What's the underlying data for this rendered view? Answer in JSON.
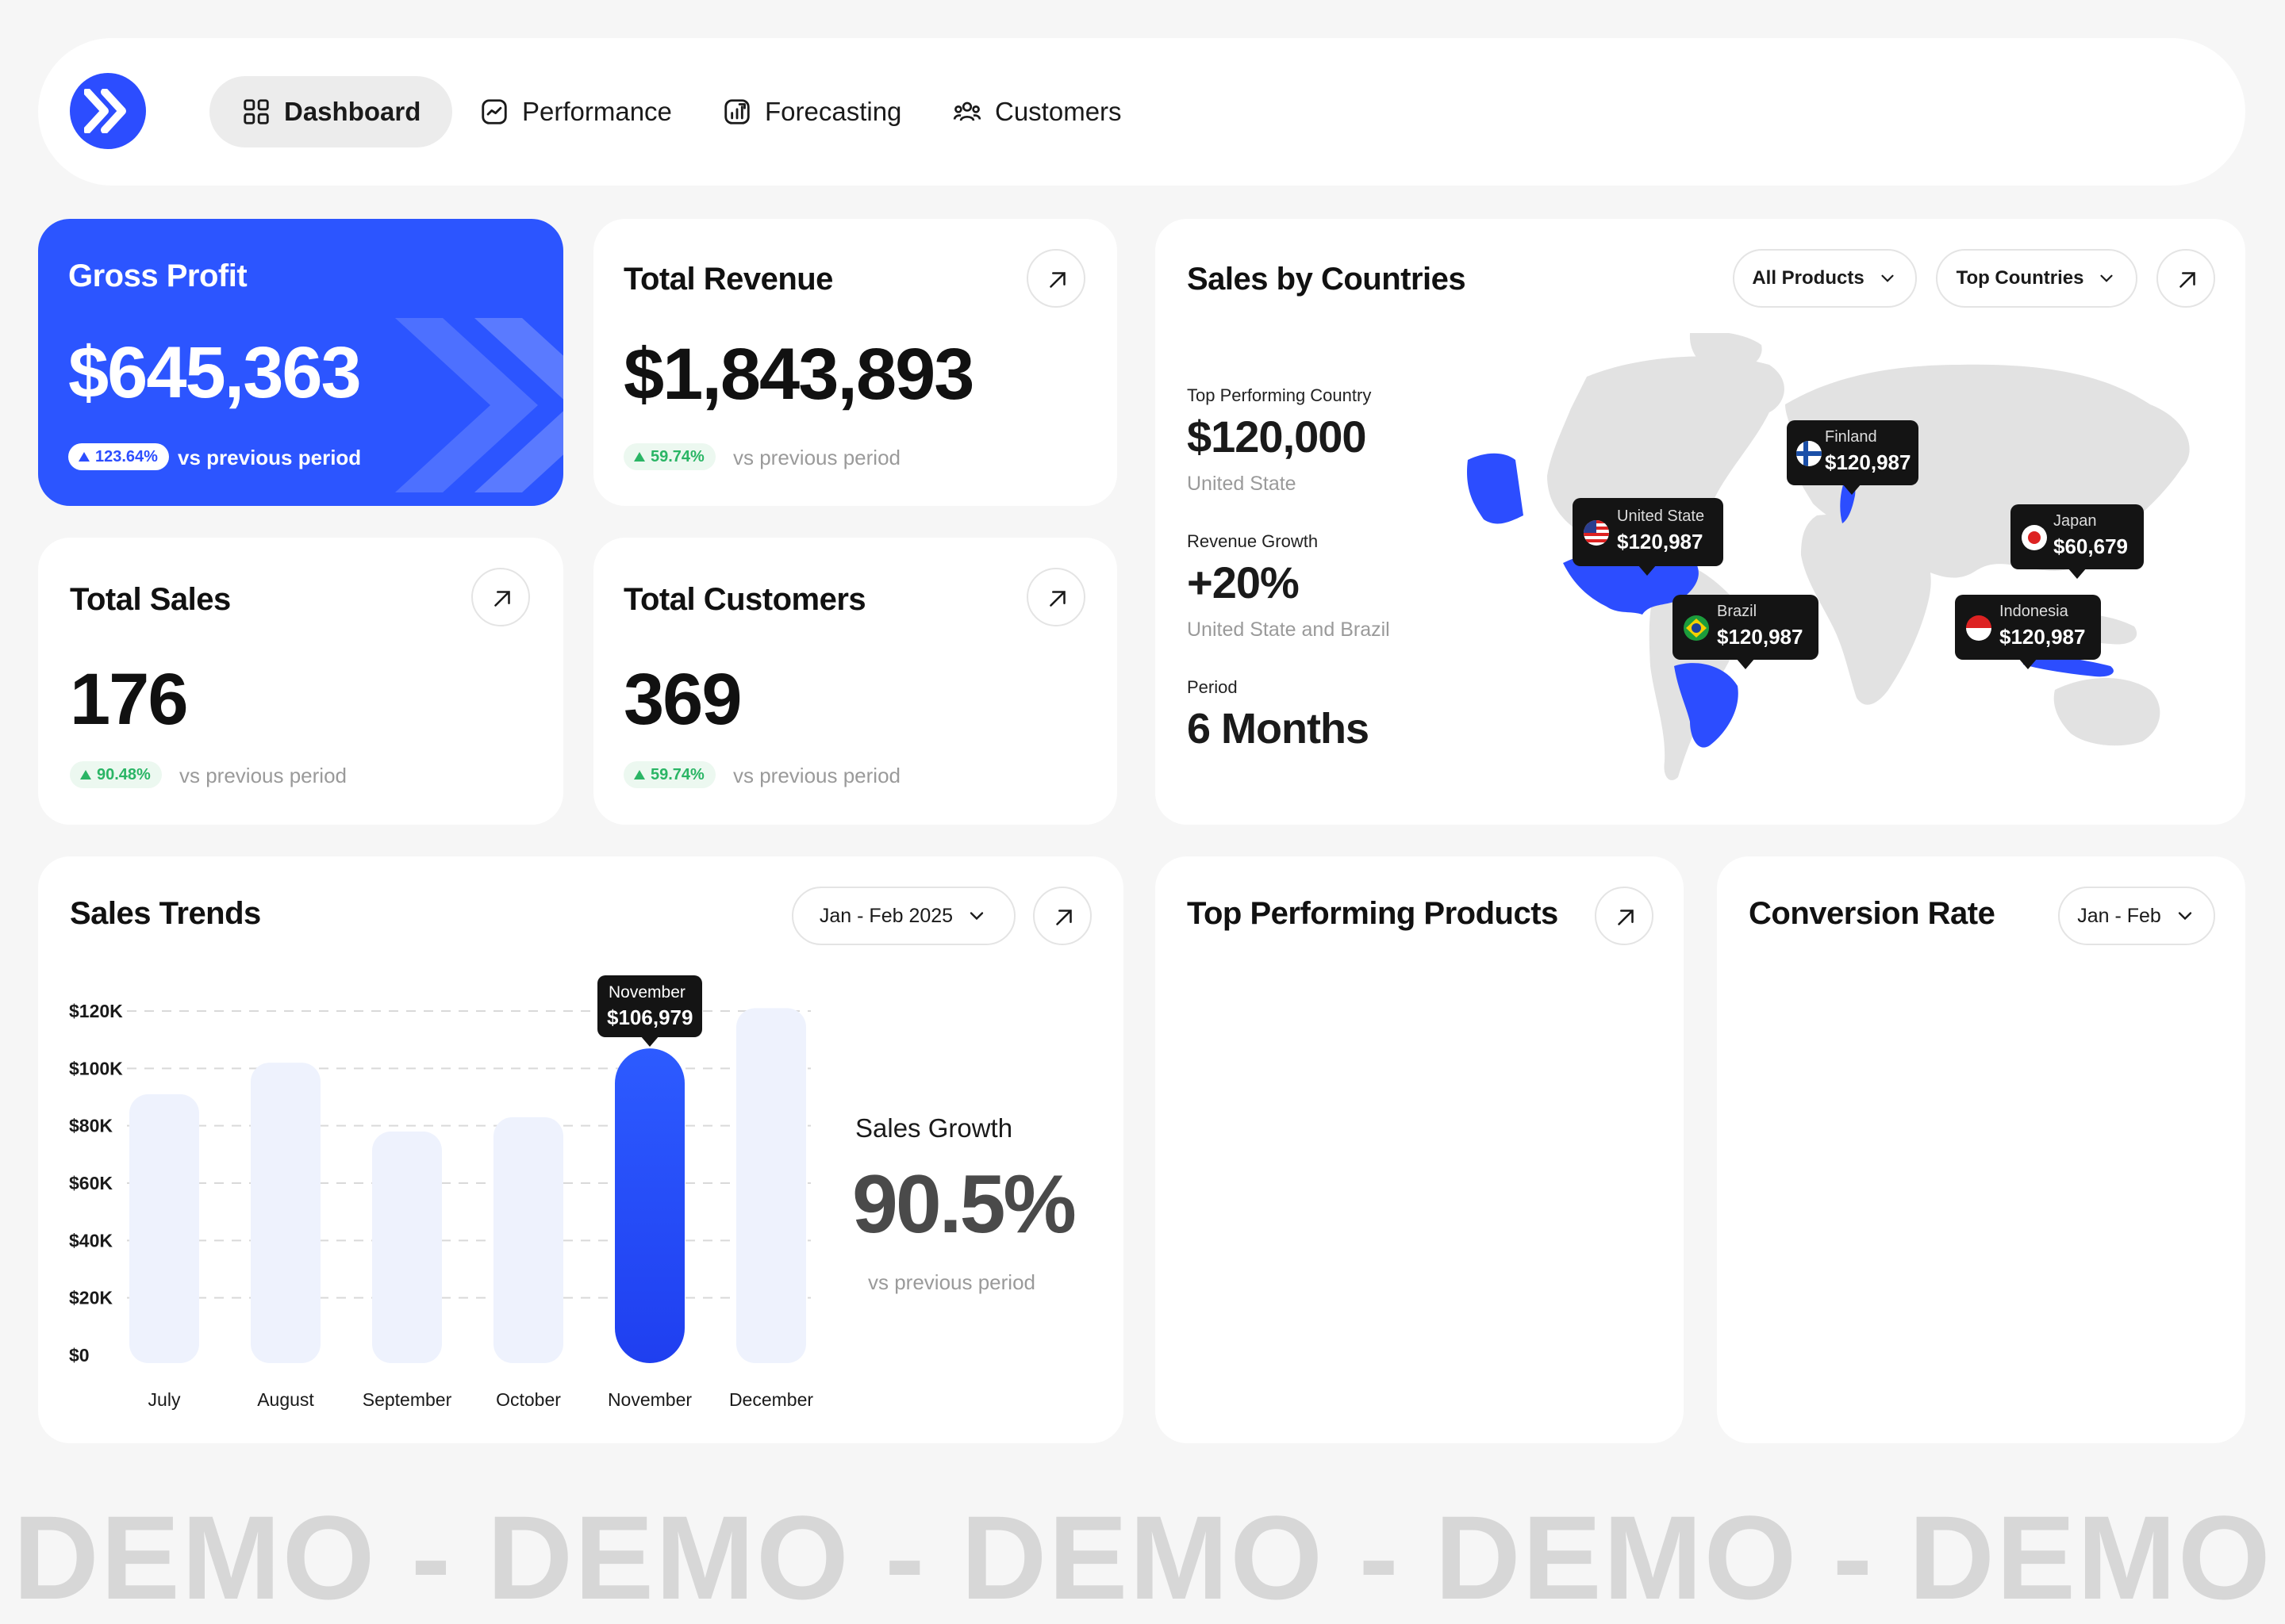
{
  "nav": {
    "tabs": [
      {
        "label": "Dashboard",
        "active": true
      },
      {
        "label": "Performance"
      },
      {
        "label": "Forecasting"
      },
      {
        "label": "Customers"
      }
    ]
  },
  "gross_profit": {
    "title": "Gross Profit",
    "value": "$645,363",
    "change": "123.64%",
    "vs": "vs previous period"
  },
  "total_revenue": {
    "title": "Total Revenue",
    "value": "$1,843,893",
    "change": "59.74%",
    "vs": "vs previous period"
  },
  "total_sales": {
    "title": "Total Sales",
    "value": "176",
    "change": "90.48%",
    "vs": "vs previous period"
  },
  "total_customers": {
    "title": "Total Customers",
    "value": "369",
    "change": "59.74%",
    "vs": "vs previous period"
  },
  "countries": {
    "title": "Sales by Countries",
    "filter_products": "All Products",
    "filter_countries": "Top Countries",
    "top_label": "Top Performing Country",
    "top_value": "$120,000",
    "top_country": "United State",
    "growth_label": "Revenue Growth",
    "growth_value": "+20%",
    "growth_countries": "United State and Brazil",
    "period_label": "Period",
    "period_value": "6 Months",
    "markers": [
      {
        "name": "United State",
        "value": "$120,987"
      },
      {
        "name": "Finland",
        "value": "$120,987"
      },
      {
        "name": "Japan",
        "value": "$60,679"
      },
      {
        "name": "Brazil",
        "value": "$120,987"
      },
      {
        "name": "Indonesia",
        "value": "$120,987"
      }
    ]
  },
  "sales_trends": {
    "title": "Sales Trends",
    "range": "Jan - Feb 2025",
    "growth_label": "Sales Growth",
    "growth_value": "90.5%",
    "growth_vs": "vs previous period",
    "tooltip_month": "November",
    "tooltip_value": "$106,979"
  },
  "top_products": {
    "title": "Top Performing Products"
  },
  "conversion": {
    "title": "Conversion Rate",
    "range": "Jan - Feb"
  },
  "watermark": "DEMO - DEMO - DEMO - DEMO - DEMO",
  "colors": {
    "accent": "#2c4dff",
    "bar_light": "#eef2fd",
    "positive": "#2ab565"
  },
  "chart_data": {
    "type": "bar",
    "categories": [
      "July",
      "August",
      "September",
      "October",
      "November",
      "December"
    ],
    "values": [
      91000,
      102000,
      78000,
      83000,
      106979,
      121000
    ],
    "highlight": "November",
    "ylim": [
      0,
      120000
    ],
    "yticks": [
      "$0",
      "$20K",
      "$40K",
      "$60K",
      "$80K",
      "$100K",
      "$120K"
    ],
    "grid": true
  }
}
